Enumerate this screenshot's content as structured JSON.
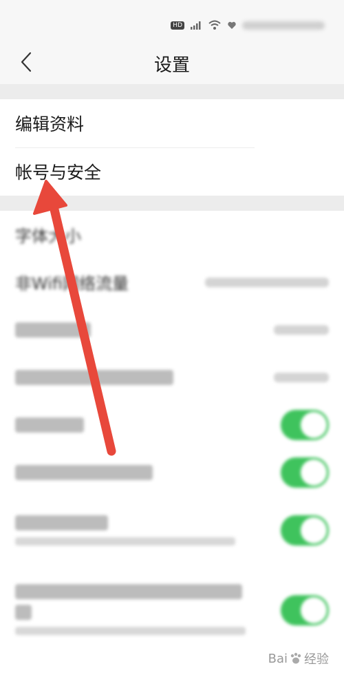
{
  "header": {
    "title": "设置"
  },
  "account_section": {
    "items": [
      {
        "label": "编辑资料"
      },
      {
        "label": "帐号与安全"
      }
    ]
  },
  "settings_section": {
    "font_size_label": "字体大小",
    "wifi_label": "非Wifi网络流量",
    "toggles_on": [
      true,
      true,
      true,
      true
    ]
  },
  "watermark": {
    "text_a": "Bai",
    "text_b": "经验"
  },
  "colors": {
    "toggle_on": "#3fc35d",
    "annotation_arrow": "#e8483b"
  }
}
